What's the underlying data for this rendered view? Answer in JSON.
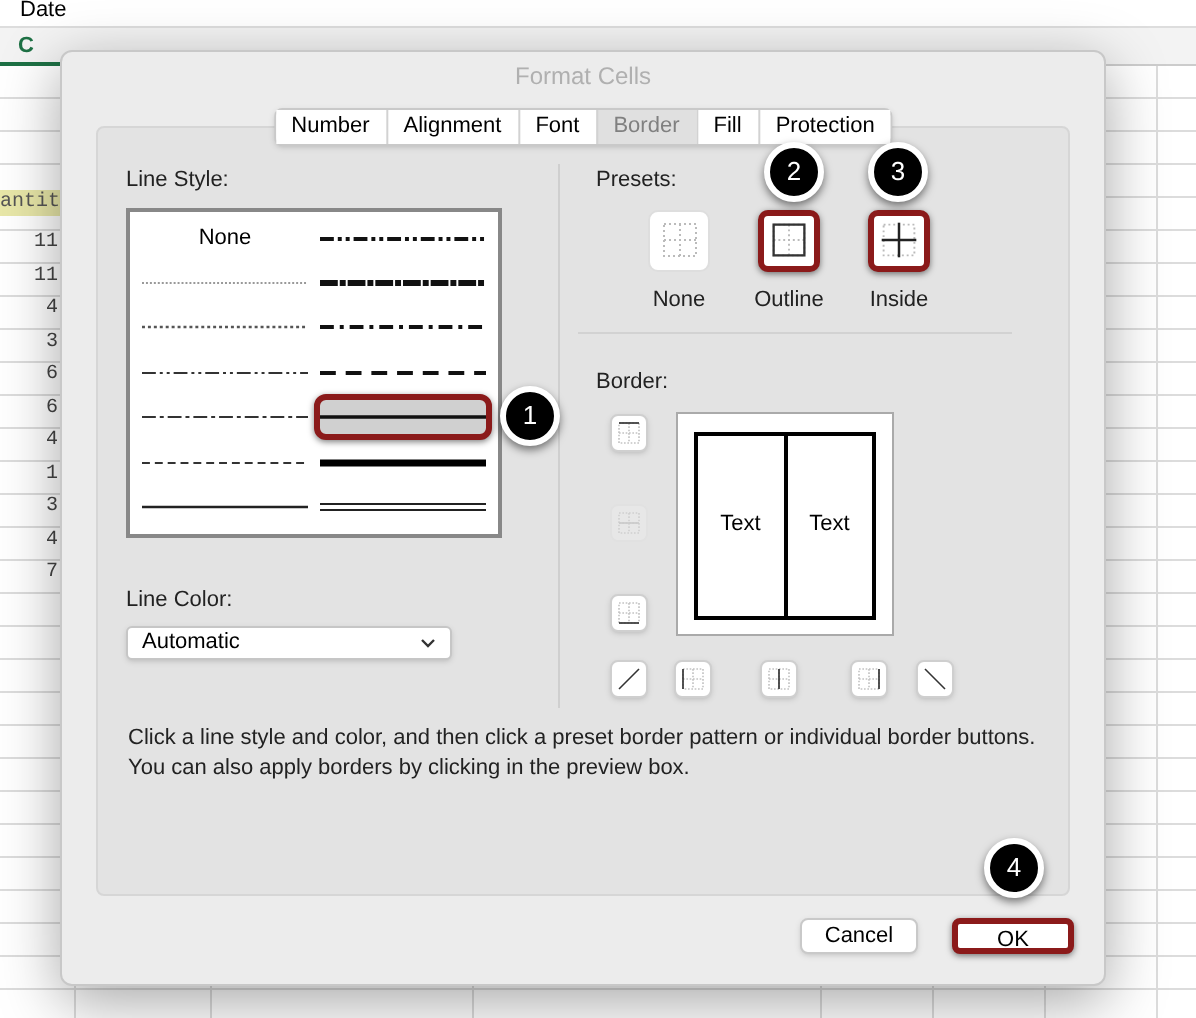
{
  "spreadsheet": {
    "formula_bar_text": "Date",
    "column_header": "C",
    "cells": [
      "antit",
      "11",
      "11",
      "4",
      "3",
      "6",
      "6",
      "4",
      "1",
      "3",
      "4",
      "7"
    ]
  },
  "dialog": {
    "title": "Format Cells",
    "tabs": [
      {
        "label": "Number",
        "selected": false
      },
      {
        "label": "Alignment",
        "selected": false
      },
      {
        "label": "Font",
        "selected": false
      },
      {
        "label": "Border",
        "selected": true
      },
      {
        "label": "Fill",
        "selected": false
      },
      {
        "label": "Protection",
        "selected": false
      }
    ],
    "line_style": {
      "label": "Line Style:",
      "options": [
        {
          "kind": "none",
          "label": "None",
          "selected": false,
          "highlighted": false
        },
        {
          "kind": "medium-dash-dot-dot",
          "selected": false,
          "highlighted": false
        },
        {
          "kind": "hair",
          "selected": false,
          "highlighted": false
        },
        {
          "kind": "slant-dash-dot",
          "selected": false,
          "highlighted": false
        },
        {
          "kind": "dotted",
          "selected": false,
          "highlighted": false
        },
        {
          "kind": "medium-dash-dot",
          "selected": false,
          "highlighted": false
        },
        {
          "kind": "dash-dot-dot",
          "selected": false,
          "highlighted": false
        },
        {
          "kind": "medium-dashed",
          "selected": false,
          "highlighted": false
        },
        {
          "kind": "dash-dot",
          "selected": false,
          "highlighted": false
        },
        {
          "kind": "medium",
          "selected": true,
          "highlighted": true
        },
        {
          "kind": "dashed",
          "selected": false,
          "highlighted": false
        },
        {
          "kind": "thick",
          "selected": false,
          "highlighted": false
        },
        {
          "kind": "thin",
          "selected": false,
          "highlighted": false
        },
        {
          "kind": "double",
          "selected": false,
          "highlighted": false
        }
      ]
    },
    "line_color": {
      "label": "Line Color:",
      "value": "Automatic"
    },
    "presets": {
      "label": "Presets:",
      "items": [
        {
          "kind": "none",
          "label": "None",
          "highlighted": false
        },
        {
          "kind": "outline",
          "label": "Outline",
          "highlighted": true
        },
        {
          "kind": "inside",
          "label": "Inside",
          "highlighted": true
        }
      ]
    },
    "border": {
      "label": "Border:",
      "side_buttons": [
        {
          "kind": "top",
          "disabled": false
        },
        {
          "kind": "middle",
          "disabled": true
        },
        {
          "kind": "bottom",
          "disabled": false
        }
      ],
      "bottom_buttons": [
        {
          "kind": "diagonal-up",
          "disabled": false
        },
        {
          "kind": "left",
          "disabled": false
        },
        {
          "kind": "center",
          "disabled": false
        },
        {
          "kind": "right",
          "disabled": false
        },
        {
          "kind": "diagonal-down",
          "disabled": false
        }
      ],
      "preview_texts": [
        "Text",
        "Text"
      ]
    },
    "help_text": "Click a line style and color, and then click a preset border pattern or individual border buttons. You can also apply borders by clicking in the preview box.",
    "buttons": [
      {
        "label": "Cancel",
        "highlighted": false
      },
      {
        "label": "OK",
        "highlighted": true
      }
    ]
  },
  "callouts": [
    "1",
    "2",
    "3",
    "4"
  ]
}
